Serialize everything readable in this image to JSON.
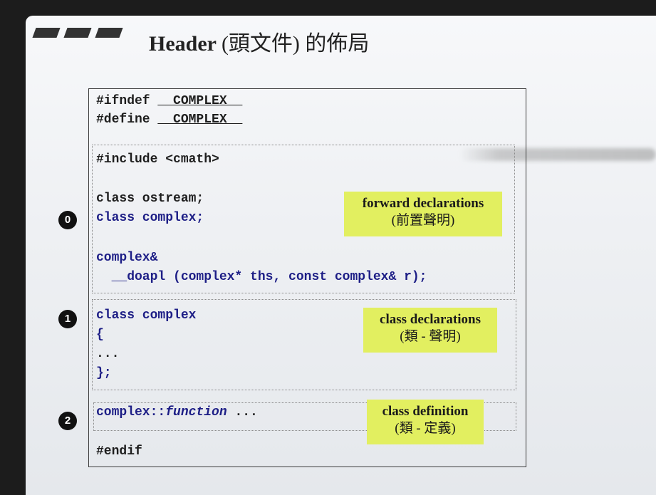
{
  "title": {
    "en": "Header",
    "zh_paren": "(頭文件)",
    "zh_rest": "的佈局"
  },
  "guard": {
    "ifndef_kw": "#ifndef ",
    "ifndef_macro": "__COMPLEX__",
    "define_kw": "#define ",
    "define_macro": "__COMPLEX__",
    "endif": "#endif"
  },
  "section0": {
    "include": "#include <cmath>",
    "fwd_ostream": "class ostream;",
    "fwd_complex": "class complex;",
    "fn_ret": "complex&",
    "fn_sig": "  __doapl (complex* ths, const complex& r);"
  },
  "section1": {
    "class_head": "class complex",
    "open_brace": "{",
    "ellipsis": "...",
    "close_brace": "};"
  },
  "section2": {
    "scope": "complex::",
    "function": "function",
    "ellipsis": " ..."
  },
  "notes": {
    "forward": {
      "en": "forward declarations",
      "zh": "(前置聲明)"
    },
    "classdecl": {
      "en": "class declarations",
      "zh": "(類 - 聲明)"
    },
    "classdef": {
      "en": "class definition",
      "zh": "(類 - 定義)"
    }
  },
  "markers": [
    "0",
    "1",
    "2"
  ],
  "colors": {
    "note_bg": "#e2ef60",
    "code_blue": "#1d1e86",
    "marker_bg": "#111111"
  }
}
